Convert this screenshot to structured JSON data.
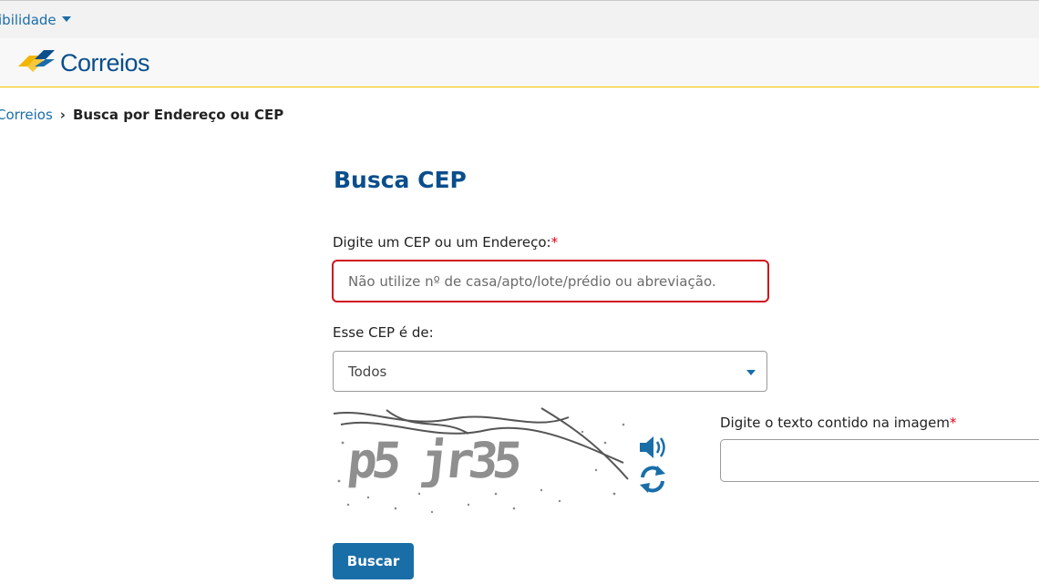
{
  "topbar": {
    "accessibility_label": "ibilidade"
  },
  "header": {
    "logo_text": "Correios"
  },
  "breadcrumb": {
    "parent": "Correios",
    "separator": "›",
    "current": "Busca por Endereço ou CEP"
  },
  "form": {
    "title": "Busca CEP",
    "cep_label": "Digite um CEP ou um Endereço:",
    "required_mark": "*",
    "cep_input": {
      "value": "",
      "placeholder": "Não utilize nº de casa/apto/lote/prédio ou abreviação."
    },
    "type_label": "Esse CEP é de:",
    "type_select_value": "Todos",
    "captcha_image_text": "p5 jr35",
    "captcha_label": "Digite o texto contido na imagem",
    "captcha_input": {
      "value": ""
    },
    "submit_label": "Buscar"
  },
  "icons": {
    "captcha_audio": "speaker-icon",
    "captcha_refresh": "refresh-icon",
    "dropdown": "chevron-down-icon"
  },
  "colors": {
    "brand_blue": "#0a4e8c",
    "link_blue": "#1a6ea8",
    "logo_yellow": "#f3b500",
    "error_red": "#d0151b",
    "required_red": "#e3001b"
  }
}
